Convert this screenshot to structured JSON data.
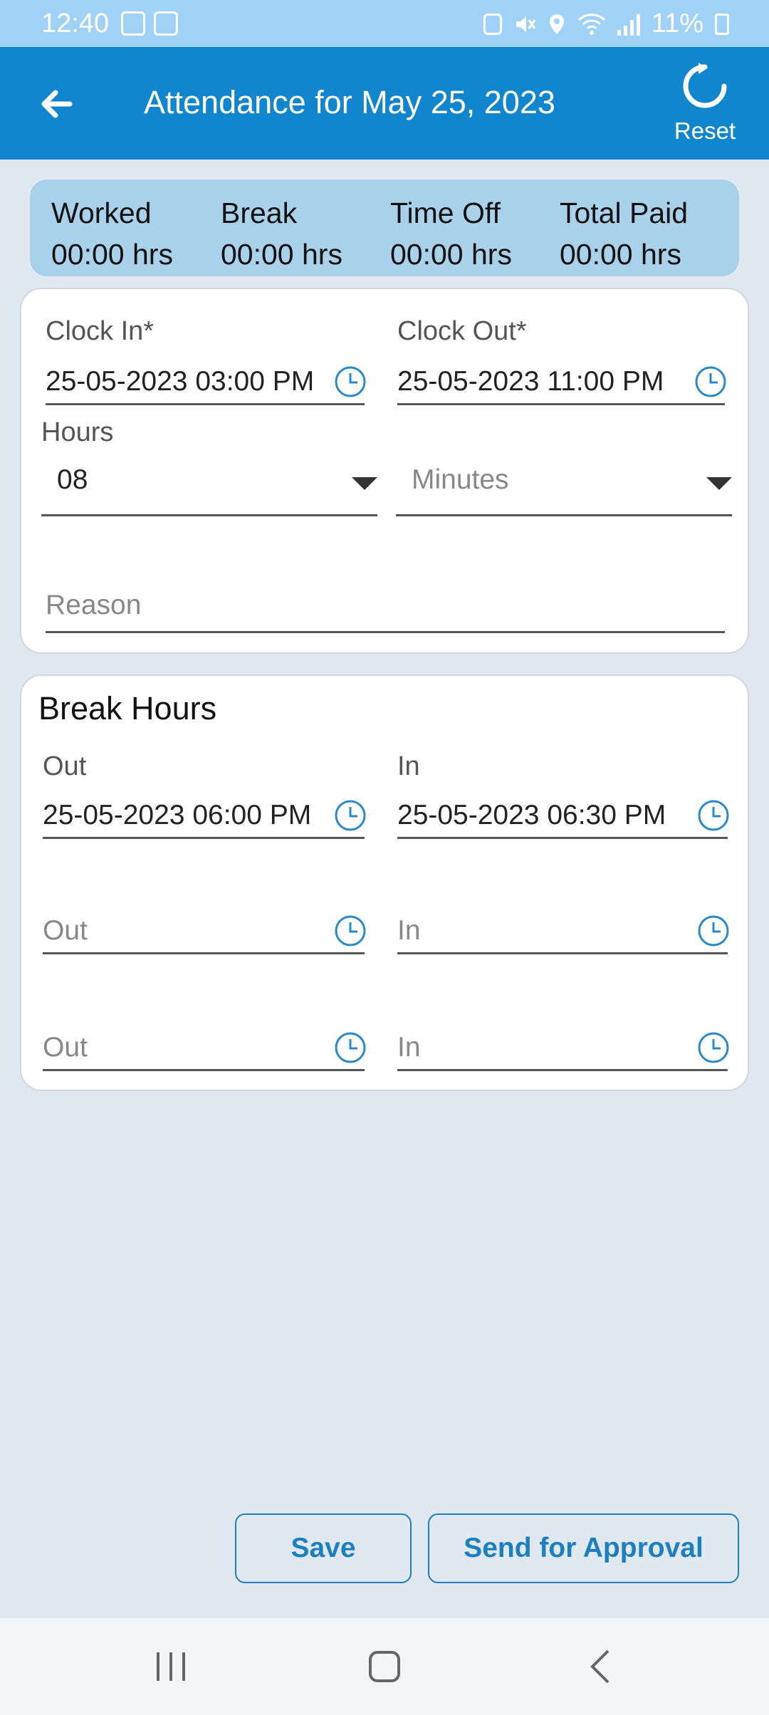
{
  "status_bar": {
    "time": "12:40",
    "battery": "11%",
    "icons": [
      "usb-icon",
      "image-icon",
      "sync-icon",
      "mute-icon",
      "location-icon",
      "wifi-icon",
      "signal-icon",
      "battery-icon"
    ]
  },
  "header": {
    "title": "Attendance for May 25, 2023",
    "reset_label": "Reset",
    "color": "#1185cd"
  },
  "summary": {
    "items": [
      {
        "label": "Worked",
        "value": "00:00 hrs"
      },
      {
        "label": "Break",
        "value": "00:00 hrs"
      },
      {
        "label": "Time Off",
        "value": "00:00 hrs"
      },
      {
        "label": "Total Paid",
        "value": "00:00 hrs"
      }
    ]
  },
  "clock": {
    "in_label": "Clock In*",
    "in_value": "25-05-2023 03:00 PM",
    "out_label": "Clock Out*",
    "out_value": "25-05-2023 11:00 PM",
    "hours_label": "Hours",
    "hours_value": "08",
    "minutes_placeholder": "Minutes",
    "reason_placeholder": "Reason"
  },
  "breaks": {
    "title": "Break Hours",
    "out_label": "Out",
    "in_label": "In",
    "rows": [
      {
        "out": "25-05-2023 06:00 PM",
        "in": "25-05-2023 06:30 PM"
      },
      {
        "out_placeholder": "Out",
        "in_placeholder": "In"
      },
      {
        "out_placeholder": "Out",
        "in_placeholder": "In"
      }
    ]
  },
  "actions": {
    "save": "Save",
    "send": "Send for Approval"
  },
  "accent_color": "#1d7fc0"
}
